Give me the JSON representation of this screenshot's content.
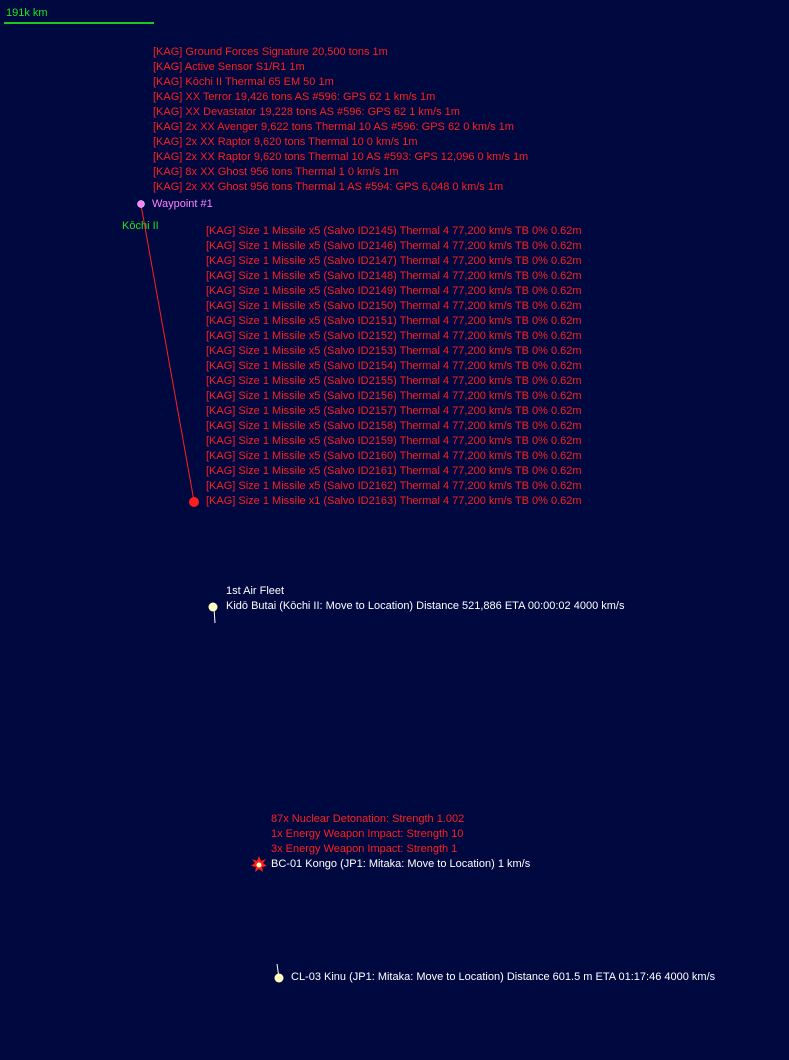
{
  "scale": {
    "label": "191k km",
    "color": "#1ec81e"
  },
  "contacts": [
    "[KAG]  Ground Forces Signature 20,500 tons   1m",
    "[KAG]  Active Sensor S1/R1  1m",
    "[KAG]  Kōchi II   Thermal 65   EM 50  1m",
    "[KAG]  XX Terror  19,426 tons    AS #596: GPS 62    1 km/s   1m",
    "[KAG]  XX Devastator  19,228 tons    AS #596: GPS 62    1 km/s   1m",
    "[KAG]  2x XX Avenger  9,622 tons    Thermal 10    AS #596: GPS 62    0 km/s   1m",
    "[KAG]  2x XX Raptor  9,620 tons    Thermal 10    0 km/s   1m",
    "[KAG]  2x XX Raptor  9,620 tons    Thermal 10    AS #593: GPS 12,096    0 km/s   1m",
    "[KAG]  8x XX Ghost  956 tons    Thermal 1    0 km/s   1m",
    "[KAG]  2x XX Ghost  956 tons    Thermal 1    AS #594: GPS 6,048    0 km/s   1m"
  ],
  "waypoint": {
    "label": "Waypoint #1",
    "color": "#ff80ff"
  },
  "body": {
    "label": "Kōchi II",
    "color": "#1ee61e"
  },
  "salvos": [
    "[KAG] Size 1 Missile x5  (Salvo ID2145)  Thermal 4  77,200 km/s  TB 0%  0.62m",
    "[KAG] Size 1 Missile x5  (Salvo ID2146)  Thermal 4  77,200 km/s  TB 0%  0.62m",
    "[KAG] Size 1 Missile x5  (Salvo ID2147)  Thermal 4  77,200 km/s  TB 0%  0.62m",
    "[KAG] Size 1 Missile x5  (Salvo ID2148)  Thermal 4  77,200 km/s  TB 0%  0.62m",
    "[KAG] Size 1 Missile x5  (Salvo ID2149)  Thermal 4  77,200 km/s  TB 0%  0.62m",
    "[KAG] Size 1 Missile x5  (Salvo ID2150)  Thermal 4  77,200 km/s  TB 0%  0.62m",
    "[KAG] Size 1 Missile x5  (Salvo ID2151)  Thermal 4  77,200 km/s  TB 0%  0.62m",
    "[KAG] Size 1 Missile x5  (Salvo ID2152)  Thermal 4  77,200 km/s  TB 0%  0.62m",
    "[KAG] Size 1 Missile x5  (Salvo ID2153)  Thermal 4  77,200 km/s  TB 0%  0.62m",
    "[KAG] Size 1 Missile x5  (Salvo ID2154)  Thermal 4  77,200 km/s  TB 0%  0.62m",
    "[KAG] Size 1 Missile x5  (Salvo ID2155)  Thermal 4  77,200 km/s  TB 0%  0.62m",
    "[KAG] Size 1 Missile x5  (Salvo ID2156)  Thermal 4  77,200 km/s  TB 0%  0.62m",
    "[KAG] Size 1 Missile x5  (Salvo ID2157)  Thermal 4  77,200 km/s  TB 0%  0.62m",
    "[KAG] Size 1 Missile x5  (Salvo ID2158)  Thermal 4  77,200 km/s  TB 0%  0.62m",
    "[KAG] Size 1 Missile x5  (Salvo ID2159)  Thermal 4  77,200 km/s  TB 0%  0.62m",
    "[KAG] Size 1 Missile x5  (Salvo ID2160)  Thermal 4  77,200 km/s  TB 0%  0.62m",
    "[KAG] Size 1 Missile x5  (Salvo ID2161)  Thermal 4  77,200 km/s  TB 0%  0.62m",
    "[KAG] Size 1 Missile x5  (Salvo ID2162)  Thermal 4  77,200 km/s  TB 0%  0.62m",
    "[KAG] Size 1 Missile x1  (Salvo ID2163)  Thermal 4  77,200 km/s  TB 0%  0.62m"
  ],
  "fleets": [
    {
      "name": "1st Air Fleet",
      "detail": "Kidō Butai  (Kōchi II: Move to Location)    Distance 521,886    ETA 00:00:02    4000 km/s"
    },
    {
      "detail": "BC-01 Kongo  (JP1: Mitaka: Move to Location)        1 km/s"
    },
    {
      "detail": "CL-03 Kinu  (JP1: Mitaka: Move to Location)    Distance 601.5 m    ETA 01:17:46    4000 km/s"
    }
  ],
  "damage": [
    "87x Nuclear Detonation: Strength 1.002",
    "1x Energy Weapon Impact: Strength 10",
    "3x Energy Weapon Impact: Strength 1"
  ],
  "colors": {
    "background": "#000840",
    "hostile": "#ff1e1e",
    "friendly": "#ffffff",
    "fleet_marker": "#ffffc0",
    "waypoint": "#ff80ff",
    "body": "#1ee61e"
  }
}
